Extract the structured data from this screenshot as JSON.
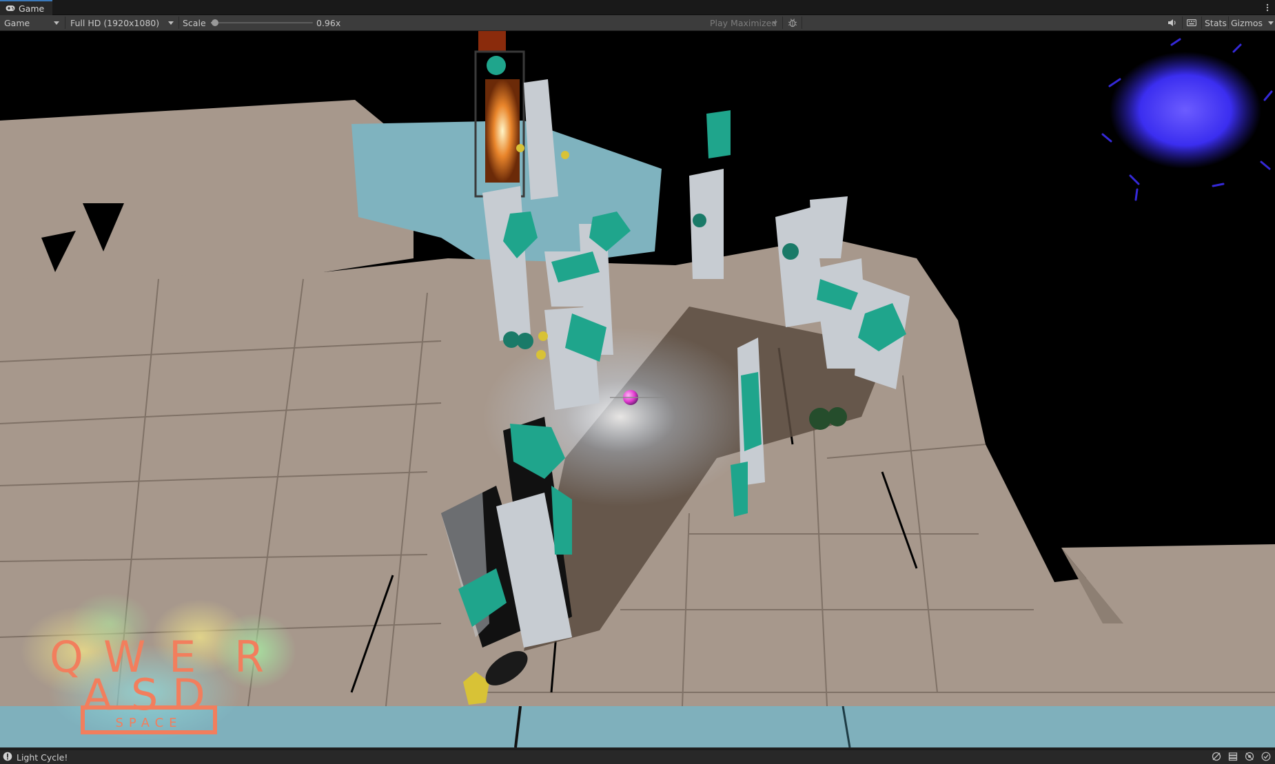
{
  "window": {
    "tab_title": "Game",
    "tab_icon": "gamepad-icon",
    "tab_menu_icon": "kebab-menu-icon"
  },
  "toolbar": {
    "display_dropdown": "Game",
    "resolution_dropdown": "Full HD (1920x1080)",
    "scale_label": "Scale",
    "scale_value": "0.96x",
    "scale_fraction": 0.04,
    "play_mode_dropdown": "Play Maximized",
    "debug_icon": "bug-icon",
    "audio_icon": "speaker-icon",
    "keyboard_icon": "keyboard-icon",
    "stats_button": "Stats",
    "gizmos_button": "Gizmos"
  },
  "game_view": {
    "overlay_keys": [
      "Q",
      "W",
      "E",
      "R",
      "A",
      "S",
      "D"
    ],
    "overlay_space": "SPACE",
    "colors": {
      "floor": "#a7988c",
      "floor_shadow": "#6b5d52",
      "pillar": "#c7ccd2",
      "gem": "#1fa58c",
      "water": "#7fb0bc",
      "light_orb": "#e23ad0",
      "particle_cloud": "#3b2ef0",
      "key_letters": "#f27e5d"
    }
  },
  "statusbar": {
    "message": "Light Cycle!",
    "message_icon": "info-icon",
    "right_icons": [
      "progress-icon",
      "layers-icon",
      "network-icon",
      "check-icon"
    ]
  }
}
